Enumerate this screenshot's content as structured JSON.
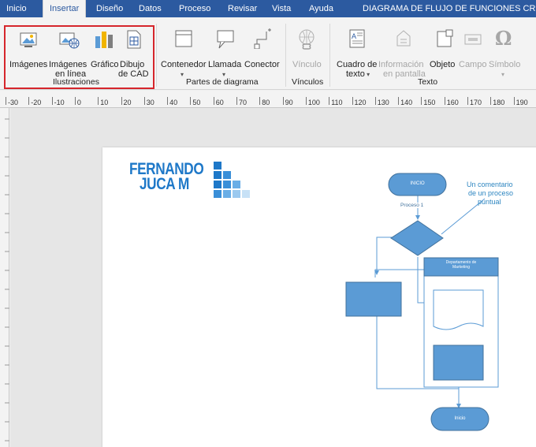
{
  "menu": {
    "tabs": [
      "Inicio",
      "Insertar",
      "Diseño",
      "Datos",
      "Proceso",
      "Revisar",
      "Vista",
      "Ayuda"
    ],
    "active_tab": "Insertar",
    "document_title": "DIAGRAMA DE FLUJO DE FUNCIONES CRUZADAS"
  },
  "ribbon": {
    "groups": {
      "ilustraciones": "Ilustraciones",
      "partes": "Partes de diagrama",
      "vinculos": "Vínculos",
      "texto": "Texto"
    },
    "buttons": {
      "imagenes": "Imágenes",
      "imagenes_linea_1": "Imágenes",
      "imagenes_linea_2": "en línea",
      "grafico": "Gráfico",
      "dibujo_1": "Dibujo",
      "dibujo_2": "de CAD",
      "contenedor": "Contenedor",
      "llamada": "Llamada",
      "conector": "Conector",
      "vinculo": "Vínculo",
      "cuadro_1": "Cuadro de",
      "cuadro_2": "texto",
      "info_1": "Información",
      "info_2": "en pantalla",
      "objeto": "Objeto",
      "campo": "Campo",
      "simbolo": "Símbolo"
    }
  },
  "ruler": {
    "labels": [
      "-30",
      "-20",
      "-10",
      "0",
      "10",
      "20",
      "30",
      "40",
      "50",
      "60",
      "70",
      "80",
      "90",
      "100",
      "110",
      "120",
      "130",
      "140",
      "150",
      "160",
      "170",
      "180",
      "190",
      "20"
    ]
  },
  "diagram": {
    "logo_line1": "FERNANDO",
    "logo_line2": "JUCA M",
    "start_label": "INICIO",
    "process1_label": "Proceso 1",
    "comment": [
      "Un comentario",
      "de un proceso",
      "puntual"
    ],
    "swimlane_title": [
      "Departamento de",
      "Marketing"
    ],
    "end_label": "Inicio"
  },
  "colors": {
    "menubar": "#2c5aa0",
    "shape_fill": "#5b9bd5",
    "shape_stroke": "#41719c",
    "highlight": "#d6262c",
    "logo": "#1e78c8"
  }
}
